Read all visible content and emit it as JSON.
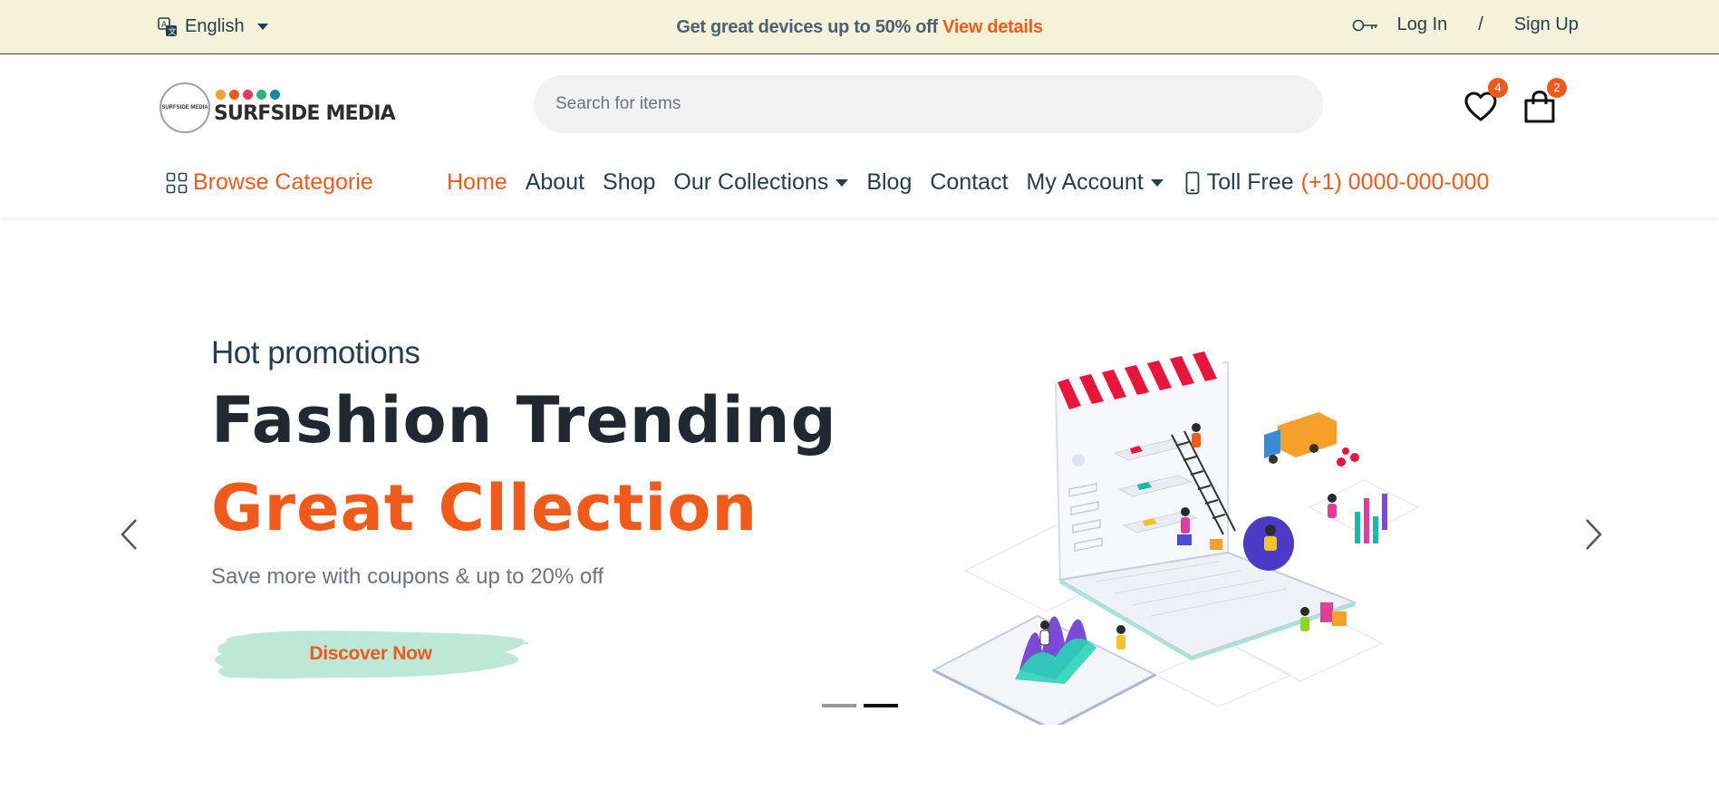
{
  "topbar": {
    "language": "English",
    "promo_text": "Get great devices up to 50% off",
    "promo_link": "View details",
    "login": "Log In",
    "separator": "/",
    "signup": "Sign Up"
  },
  "header": {
    "logo_text": "SURFSIDE MEDIA",
    "logo_dot_colors": [
      "#f4a02a",
      "#f05a1a",
      "#e23c5c",
      "#2bb673",
      "#138b9a"
    ],
    "search_placeholder": "Search for items",
    "wishlist_count": "4",
    "cart_count": "2"
  },
  "nav": {
    "browse": "Browse Categorie",
    "items": [
      {
        "label": "Home",
        "active": true
      },
      {
        "label": "About"
      },
      {
        "label": "Shop"
      },
      {
        "label": "Our Collections",
        "dropdown": true
      },
      {
        "label": "Blog"
      },
      {
        "label": "Contact"
      },
      {
        "label": "My Account",
        "dropdown": true
      }
    ],
    "toll_free_label": "Toll Free",
    "phone": "(+1) 0000-000-000"
  },
  "hero": {
    "eyebrow": "Hot promotions",
    "title_line1": "Fashion Trending",
    "title_line2": "Great Cllection",
    "subtitle": "Save more with coupons & up to 20% off",
    "cta": "Discover Now",
    "slides": 2,
    "active_slide": 2
  },
  "colors": {
    "accent": "#f05a1a",
    "topbar_bg": "#f4f3d9",
    "cta_brush": "#bde8d7",
    "text_dark": "#253d4e"
  }
}
